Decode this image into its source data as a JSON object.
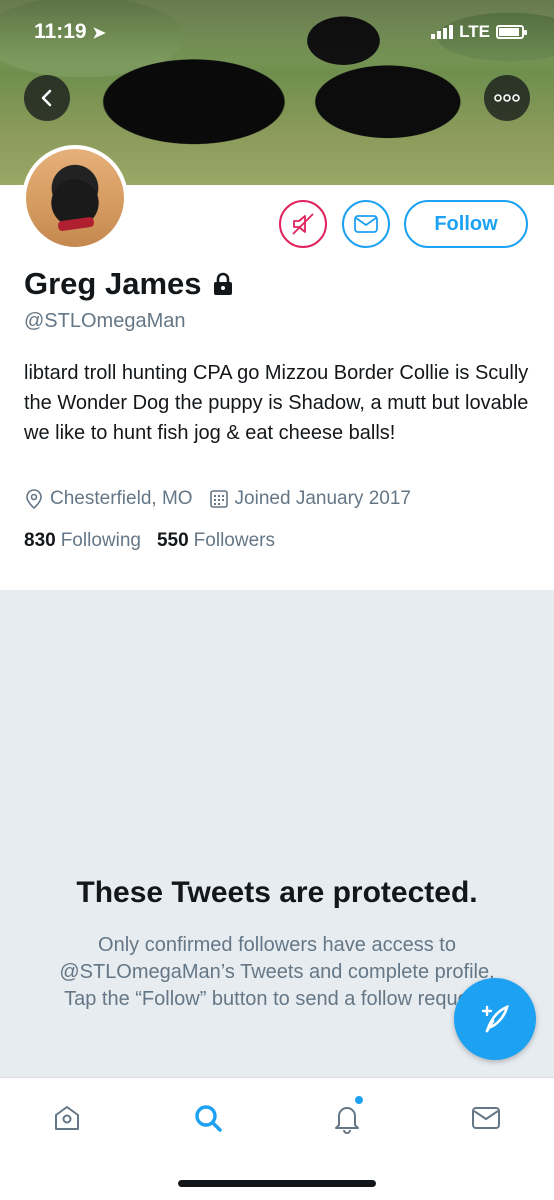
{
  "status_bar": {
    "time": "11:19",
    "network": "LTE"
  },
  "profile": {
    "name": "Greg James",
    "handle": "@STLOmegaMan",
    "bio": "libtard troll hunting CPA go Mizzou Border Collie is Scully the Wonder Dog the puppy is Shadow, a mutt but lovable we like to hunt fish jog & eat cheese balls!",
    "location": "Chesterfield, MO",
    "joined": "Joined January 2017",
    "following_count": "830",
    "following_label": "Following",
    "followers_count": "550",
    "followers_label": "Followers"
  },
  "actions": {
    "follow_label": "Follow"
  },
  "protected": {
    "title": "These Tweets are protected.",
    "message": "Only confirmed followers have access to @STLOmegaMan’s Tweets and complete profile. Tap the “Follow” button to send a follow request."
  },
  "icons": {
    "back": "chevron-left-icon",
    "more": "more-icon",
    "mute": "mute-icon",
    "message": "envelope-icon",
    "lock": "lock-icon",
    "location": "location-pin-icon",
    "calendar": "calendar-icon",
    "compose": "compose-quill-icon",
    "home": "home-icon",
    "search": "search-icon",
    "notifications": "bell-icon",
    "messages": "mail-icon"
  },
  "colors": {
    "accent": "#1da1f2",
    "mute": "#e0245e",
    "text_secondary": "#657786",
    "background_protected": "#e6ecf0"
  }
}
